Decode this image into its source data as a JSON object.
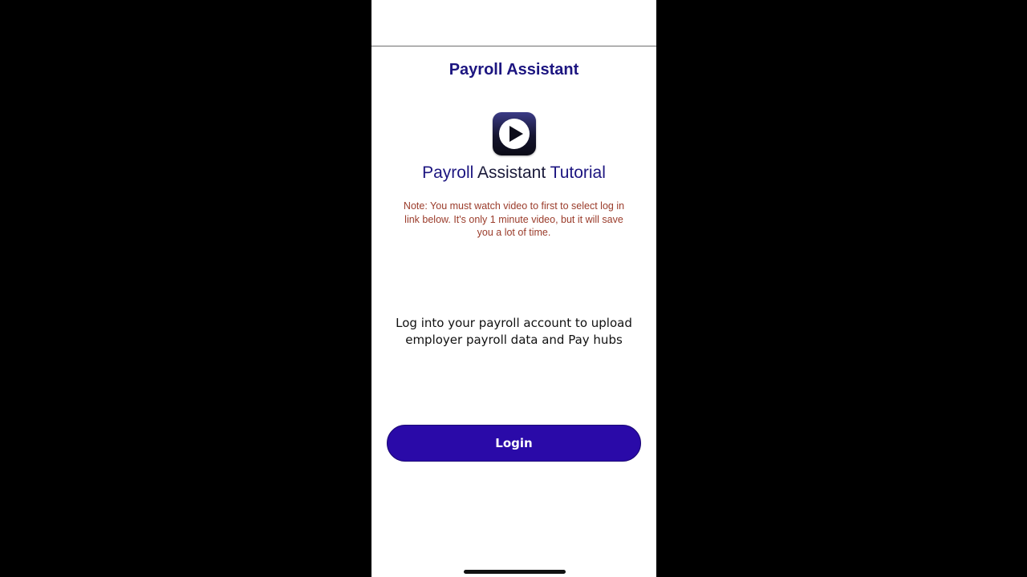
{
  "header": {
    "title": "Payroll Assistant"
  },
  "tutorial": {
    "icon": "play-video-icon",
    "title_part1": "Payroll",
    "title_part2": "Assistant",
    "title_part3": "Tutorial",
    "note": "Note: You must watch video to first to select log in link below. It's only 1 minute video, but it will save you a lot of time."
  },
  "login": {
    "description": "Log into your payroll account to upload employer payroll data and Pay hubs",
    "button_label": "Login"
  },
  "colors": {
    "accent": "#2a0aa8",
    "title": "#1c1580",
    "note": "#9a3b2a"
  }
}
